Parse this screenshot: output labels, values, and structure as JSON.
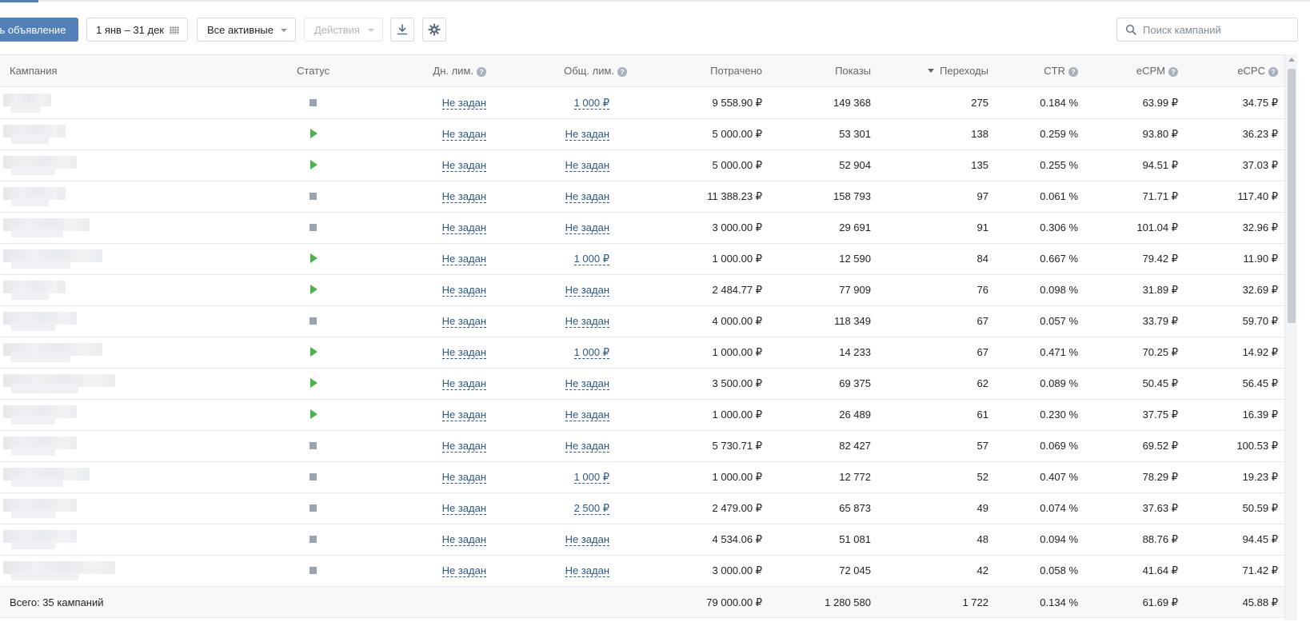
{
  "toolbar": {
    "create_ad_label": "ть объявление",
    "date_range": "1 янв – 31 дек",
    "filter_label": "Все активные",
    "actions_label": "Действия"
  },
  "search": {
    "placeholder": "Поиск кампаний"
  },
  "table": {
    "columns": {
      "campaign": "Кампания",
      "status": "Статус",
      "daily_limit": "Дн. лим.",
      "total_limit": "Общ. лим.",
      "spent": "Потрачено",
      "impressions": "Показы",
      "clicks": "Переходы",
      "ctr": "CTR",
      "ecpm": "eCPM",
      "ecpc": "eCPC"
    },
    "sorted_by": "clicks",
    "rows": [
      {
        "status": "stopped",
        "daily_limit": "Не задан",
        "total_limit": "1 000 ₽",
        "spent": "9 558.90 ₽",
        "impressions": "149 368",
        "clicks": "275",
        "ctr": "0.184 %",
        "ecpm": "63.99 ₽",
        "ecpc": "34.75 ₽"
      },
      {
        "status": "active",
        "daily_limit": "Не задан",
        "total_limit": "Не задан",
        "spent": "5 000.00 ₽",
        "impressions": "53 301",
        "clicks": "138",
        "ctr": "0.259 %",
        "ecpm": "93.80 ₽",
        "ecpc": "36.23 ₽"
      },
      {
        "status": "active",
        "daily_limit": "Не задан",
        "total_limit": "Не задан",
        "spent": "5 000.00 ₽",
        "impressions": "52 904",
        "clicks": "135",
        "ctr": "0.255 %",
        "ecpm": "94.51 ₽",
        "ecpc": "37.03 ₽"
      },
      {
        "status": "stopped",
        "daily_limit": "Не задан",
        "total_limit": "Не задан",
        "spent": "11 388.23 ₽",
        "impressions": "158 793",
        "clicks": "97",
        "ctr": "0.061 %",
        "ecpm": "71.71 ₽",
        "ecpc": "117.40 ₽"
      },
      {
        "status": "stopped",
        "daily_limit": "Не задан",
        "total_limit": "Не задан",
        "spent": "3 000.00 ₽",
        "impressions": "29 691",
        "clicks": "91",
        "ctr": "0.306 %",
        "ecpm": "101.04 ₽",
        "ecpc": "32.96 ₽"
      },
      {
        "status": "active",
        "daily_limit": "Не задан",
        "total_limit": "1 000 ₽",
        "spent": "1 000.00 ₽",
        "impressions": "12 590",
        "clicks": "84",
        "ctr": "0.667 %",
        "ecpm": "79.42 ₽",
        "ecpc": "11.90 ₽"
      },
      {
        "status": "active",
        "daily_limit": "Не задан",
        "total_limit": "Не задан",
        "spent": "2 484.77 ₽",
        "impressions": "77 909",
        "clicks": "76",
        "ctr": "0.098 %",
        "ecpm": "31.89 ₽",
        "ecpc": "32.69 ₽"
      },
      {
        "status": "stopped",
        "daily_limit": "Не задан",
        "total_limit": "Не задан",
        "spent": "4 000.00 ₽",
        "impressions": "118 349",
        "clicks": "67",
        "ctr": "0.057 %",
        "ecpm": "33.79 ₽",
        "ecpc": "59.70 ₽"
      },
      {
        "status": "active",
        "daily_limit": "Не задан",
        "total_limit": "1 000 ₽",
        "spent": "1 000.00 ₽",
        "impressions": "14 233",
        "clicks": "67",
        "ctr": "0.471 %",
        "ecpm": "70.25 ₽",
        "ecpc": "14.92 ₽"
      },
      {
        "status": "active",
        "daily_limit": "Не задан",
        "total_limit": "Не задан",
        "spent": "3 500.00 ₽",
        "impressions": "69 375",
        "clicks": "62",
        "ctr": "0.089 %",
        "ecpm": "50.45 ₽",
        "ecpc": "56.45 ₽"
      },
      {
        "status": "active",
        "daily_limit": "Не задан",
        "total_limit": "Не задан",
        "spent": "1 000.00 ₽",
        "impressions": "26 489",
        "clicks": "61",
        "ctr": "0.230 %",
        "ecpm": "37.75 ₽",
        "ecpc": "16.39 ₽"
      },
      {
        "status": "stopped",
        "daily_limit": "Не задан",
        "total_limit": "Не задан",
        "spent": "5 730.71 ₽",
        "impressions": "82 427",
        "clicks": "57",
        "ctr": "0.069 %",
        "ecpm": "69.52 ₽",
        "ecpc": "100.53 ₽"
      },
      {
        "status": "stopped",
        "daily_limit": "Не задан",
        "total_limit": "1 000 ₽",
        "spent": "1 000.00 ₽",
        "impressions": "12 772",
        "clicks": "52",
        "ctr": "0.407 %",
        "ecpm": "78.29 ₽",
        "ecpc": "19.23 ₽"
      },
      {
        "status": "stopped",
        "daily_limit": "Не задан",
        "total_limit": "2 500 ₽",
        "spent": "2 479.00 ₽",
        "impressions": "65 873",
        "clicks": "49",
        "ctr": "0.074 %",
        "ecpm": "37.63 ₽",
        "ecpc": "50.59 ₽"
      },
      {
        "status": "stopped",
        "daily_limit": "Не задан",
        "total_limit": "Не задан",
        "spent": "4 534.06 ₽",
        "impressions": "51 081",
        "clicks": "48",
        "ctr": "0.094 %",
        "ecpm": "88.76 ₽",
        "ecpc": "94.45 ₽"
      },
      {
        "status": "stopped",
        "daily_limit": "Не задан",
        "total_limit": "Не задан",
        "spent": "3 000.00 ₽",
        "impressions": "72 045",
        "clicks": "42",
        "ctr": "0.058 %",
        "ecpm": "41.64 ₽",
        "ecpc": "71.42 ₽"
      }
    ],
    "totals": {
      "label": "Всего: 35 кампаний",
      "spent": "79 000.00 ₽",
      "impressions": "1 280 580",
      "clicks": "1 722",
      "ctr": "0.134 %",
      "ecpm": "61.69 ₽",
      "ecpc": "45.88 ₽"
    }
  },
  "colors": {
    "accent": "#5181b8",
    "link": "#2a5885",
    "status_active": "#4bb34b",
    "status_stopped": "#9aa4b0",
    "header_bg": "#f7f8fa",
    "border": "#e7e8ec"
  }
}
